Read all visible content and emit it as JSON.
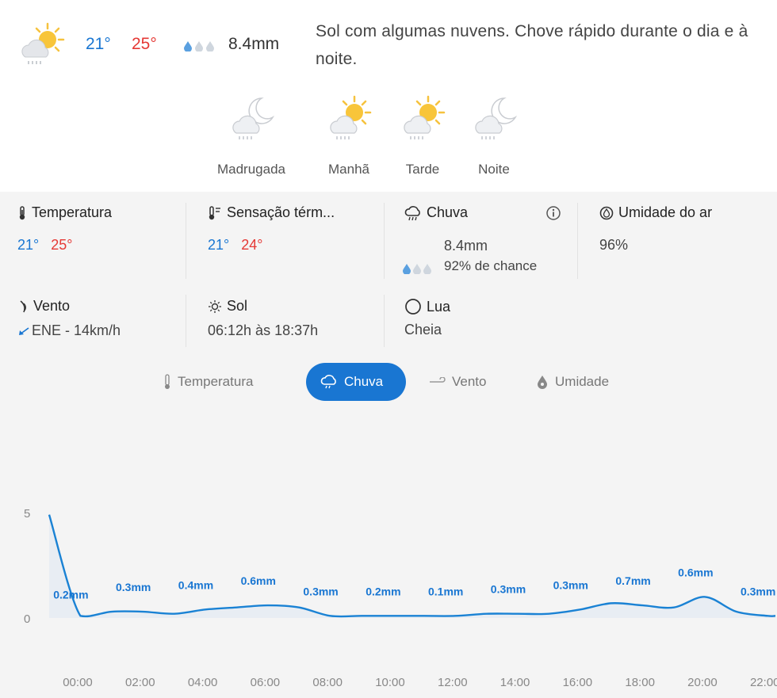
{
  "summary": {
    "temp_min": "21°",
    "temp_max": "25°",
    "rain": "8.4mm",
    "description": "Sol com algumas nuvens. Chove rápido durante o dia e à noite."
  },
  "periods": [
    {
      "label": "Madrugada",
      "icon": "cloud-moon-rain-icon"
    },
    {
      "label": "Manhã",
      "icon": "sun-cloud-rain-icon"
    },
    {
      "label": "Tarde",
      "icon": "sun-cloud-rain-icon"
    },
    {
      "label": "Noite",
      "icon": "cloud-moon-rain-icon"
    }
  ],
  "details": {
    "temperatura": {
      "title": "Temperatura",
      "min": "21°",
      "max": "25°"
    },
    "sensacao": {
      "title": "Sensação térm...",
      "min": "21°",
      "max": "24°"
    },
    "chuva": {
      "title": "Chuva",
      "amount": "8.4mm",
      "chance": "92% de chance"
    },
    "umidade": {
      "title": "Umidade do ar",
      "value": "96%"
    },
    "vento": {
      "title": "Vento",
      "value": "ENE - 14km/h"
    },
    "sol": {
      "title": "Sol",
      "value": "06:12h às 18:37h"
    },
    "lua": {
      "title": "Lua",
      "value": "Cheia"
    }
  },
  "tabs": [
    {
      "label": "Temperatura",
      "active": false
    },
    {
      "label": "Chuva",
      "active": true
    },
    {
      "label": "Vento",
      "active": false
    },
    {
      "label": "Umidade",
      "active": false
    }
  ],
  "colors": {
    "accent": "#1976d2",
    "min": "#1976d2",
    "max": "#e53935",
    "rain_line": "#1a82d4"
  },
  "chart_data": {
    "type": "area",
    "title": "",
    "xlabel": "",
    "ylabel": "",
    "ylim": [
      0,
      10
    ],
    "yticks": [
      "0",
      "5",
      "10"
    ],
    "xticks": [
      "00:00",
      "02:00",
      "04:00",
      "06:00",
      "08:00",
      "10:00",
      "12:00",
      "14:00",
      "16:00",
      "18:00",
      "20:00",
      "22:00"
    ],
    "x_hours": [
      0,
      1,
      2,
      3,
      4,
      5,
      6,
      7,
      8,
      9,
      10,
      11,
      12,
      13,
      14,
      15,
      16,
      17,
      18,
      19,
      20,
      21,
      22,
      23
    ],
    "values": [
      4.9,
      0.1,
      0.3,
      0.3,
      0.2,
      0.4,
      0.5,
      0.6,
      0.5,
      0.1,
      0.1,
      0.1,
      0.1,
      0.1,
      0.2,
      0.2,
      0.2,
      0.4,
      0.7,
      0.6,
      0.5,
      1.0,
      0.3,
      0.1
    ],
    "labels": [
      {
        "text": "0.2mm",
        "hour": 1
      },
      {
        "text": "0.3mm",
        "hour": 3
      },
      {
        "text": "0.4mm",
        "hour": 5
      },
      {
        "text": "0.6mm",
        "hour": 7
      },
      {
        "text": "0.3mm",
        "hour": 9
      },
      {
        "text": "0.2mm",
        "hour": 11
      },
      {
        "text": "0.1mm",
        "hour": 13
      },
      {
        "text": "0.3mm",
        "hour": 15
      },
      {
        "text": "0.3mm",
        "hour": 17
      },
      {
        "text": "0.7mm",
        "hour": 19
      },
      {
        "text": "0.6mm",
        "hour": 21
      },
      {
        "text": "0.3mm",
        "hour": 23
      }
    ]
  }
}
